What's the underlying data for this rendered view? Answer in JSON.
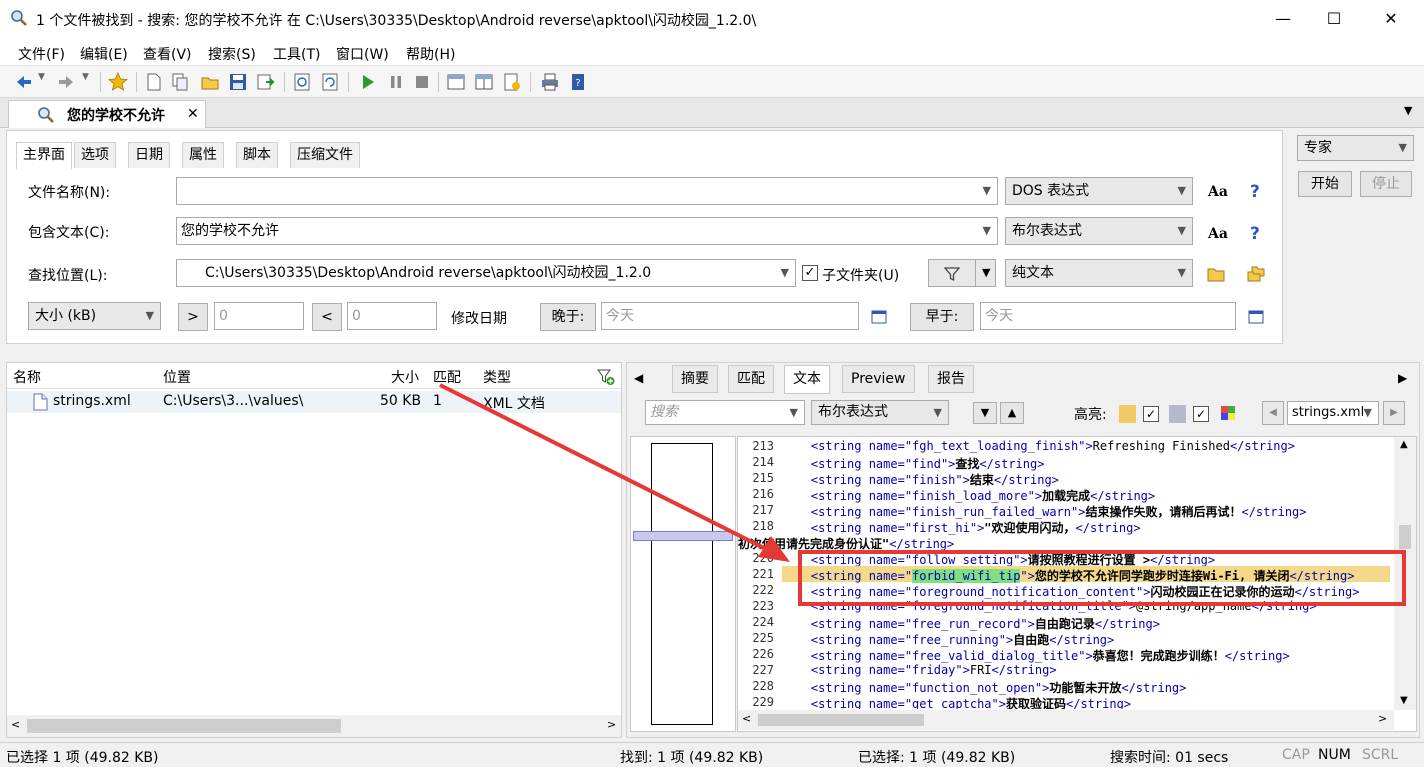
{
  "window": {
    "title": "1 个文件被找到 - 搜索: 您的学校不允许 在 C:\\Users\\30335\\Desktop\\Android reverse\\apktool\\闪动校园_1.2.0\\",
    "controls": [
      "—",
      "☐",
      "✕"
    ]
  },
  "menu": [
    "文件(F)",
    "编辑(E)",
    "查看(V)",
    "搜索(S)",
    "工具(T)",
    "窗口(W)",
    "帮助(H)"
  ],
  "doc_tab": {
    "label": "您的学校不允许",
    "close": "✕"
  },
  "search_tabs": [
    "主界面",
    "选项",
    "日期",
    "属性",
    "脚本",
    "压缩文件"
  ],
  "form": {
    "filename_label": "文件名称(N):",
    "filename_value": "",
    "filename_mode": "DOS 表达式",
    "contains_label": "包含文本(C):",
    "contains_value": "您的学校不允许",
    "contains_mode": "布尔表达式",
    "lookin_label": "查找位置(L):",
    "lookin_value": "C:\\Users\\30335\\Desktop\\Android reverse\\apktool\\闪动校园_1.2.0",
    "subfolders_label": "子文件夹(U)",
    "lookin_mode": "纯文本",
    "size_mode": "大小 (kB)",
    "gt": ">",
    "gt_value": "0",
    "lt": "<",
    "lt_value": "0",
    "date_label": "修改日期",
    "after_label": "晚于:",
    "after_value": "今天",
    "before_label": "早于:",
    "before_value": "今天",
    "aa": "Aa",
    "help": "?"
  },
  "side": {
    "mode": "专家",
    "start": "开始",
    "stop": "停止"
  },
  "results": {
    "columns": [
      "名称",
      "位置",
      "大小",
      "匹配",
      "类型"
    ],
    "rows": [
      {
        "name": "strings.xml",
        "location": "C:\\Users\\3...\\values\\",
        "size": "50 KB",
        "hits": "1",
        "type": "XML 文档"
      }
    ]
  },
  "preview": {
    "tabs": [
      "摘要",
      "匹配",
      "文本",
      "Preview",
      "报告"
    ],
    "search_placeholder": "搜索",
    "search_mode": "布尔表达式",
    "highlight_label": "高亮:",
    "file": "strings.xml",
    "lines": [
      {
        "n": "213",
        "name": "fgh_text_loading_finish",
        "text": "Refreshing Finished"
      },
      {
        "n": "214",
        "name": "find",
        "text": "查找"
      },
      {
        "n": "215",
        "name": "finish",
        "text": "结束"
      },
      {
        "n": "216",
        "name": "finish_load_more",
        "text": "加载完成"
      },
      {
        "n": "217",
        "name": "finish_run_failed_warn",
        "text": "结束操作失败，请稍后再试！"
      },
      {
        "n": "218",
        "name": "first_hi",
        "text": "\"欢迎使用闪动，"
      },
      {
        "n": "219",
        "name": "",
        "text": "初次使用请先完成身份认证\""
      },
      {
        "n": "220",
        "name": "follow_setting",
        "text": "请按照教程进行设置 >"
      },
      {
        "n": "221",
        "name": "forbid_wifi_tip",
        "text": "您的学校不允许同学跑步时连接Wi-Fi, 请关闭"
      },
      {
        "n": "222",
        "name": "foreground_notification_content",
        "text": "闪动校园正在记录你的运动"
      },
      {
        "n": "223",
        "name": "foreground_notification_title",
        "text": "@string/app_name"
      },
      {
        "n": "224",
        "name": "free_run_record",
        "text": "自由跑记录"
      },
      {
        "n": "225",
        "name": "free_running",
        "text": "自由跑"
      },
      {
        "n": "226",
        "name": "free_valid_dialog_title",
        "text": "恭喜您！完成跑步训练！"
      },
      {
        "n": "227",
        "name": "friday",
        "text": "FRI"
      },
      {
        "n": "228",
        "name": "function_not_open",
        "text": "功能暂未开放"
      },
      {
        "n": "229",
        "name": "get_captcha",
        "text": "获取验证码"
      }
    ]
  },
  "status": {
    "selected_left": "已选择 1 项 (49.82 KB)",
    "found": "找到: 1 项 (49.82 KB)",
    "selected_right": "已选择: 1 项 (49.82 KB)",
    "time": "搜索时间: 01 secs",
    "cap": "CAP",
    "num": "NUM",
    "scrl": "SCRL"
  },
  "colors": {
    "highlight_line": "#f5d98a",
    "annotation": "#e53935",
    "match_green": "#7ee07e"
  }
}
